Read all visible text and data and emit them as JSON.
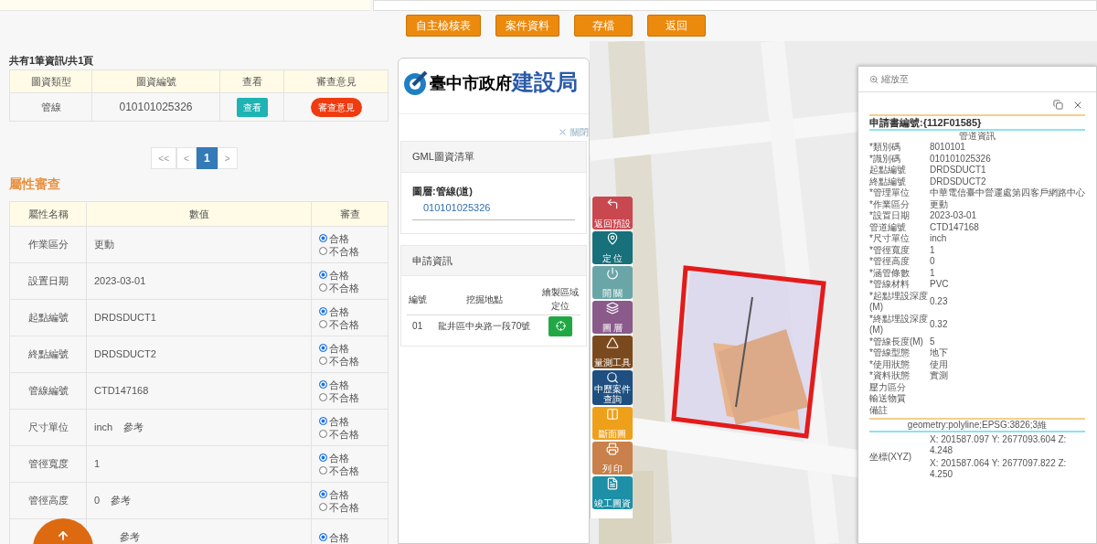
{
  "header_buttons": [
    "自主檢核表",
    "案件資料",
    "存檔",
    "返回"
  ],
  "summary": "共有1筆資訊/共1頁",
  "drawings_table": {
    "columns": [
      "圖資類型",
      "圖資編號",
      "查看",
      "審查意見"
    ],
    "rows": [
      {
        "type": "管線",
        "number": "010101025326",
        "view_button": "查看",
        "review_button": "審查意見"
      }
    ]
  },
  "pagination": [
    {
      "label": "<<",
      "selected": false
    },
    {
      "label": "<",
      "selected": false
    },
    {
      "label": "1",
      "selected": true
    },
    {
      "label": ">",
      "selected": false
    }
  ],
  "section_title": "屬性審查",
  "attributes_table": {
    "columns": [
      "屬性名稱",
      "數值",
      "審查"
    ],
    "rows": [
      {
        "name": "作業區分",
        "value": "更動",
        "options": [
          {
            "label": "合格",
            "selected": true
          },
          {
            "label": "不合格",
            "selected": false
          }
        ]
      },
      {
        "name": "設置日期",
        "value": "2023-03-01",
        "options": [
          {
            "label": "合格",
            "selected": true
          },
          {
            "label": "不合格",
            "selected": false
          }
        ]
      },
      {
        "name": "起點編號",
        "value": "DRDSDUCT1",
        "options": [
          {
            "label": "合格",
            "selected": true
          },
          {
            "label": "不合格",
            "selected": false
          }
        ]
      },
      {
        "name": "終點編號",
        "value": "DRDSDUCT2",
        "options": [
          {
            "label": "合格",
            "selected": true
          },
          {
            "label": "不合格",
            "selected": false
          }
        ]
      },
      {
        "name": "管線編號",
        "value": "CTD147168",
        "options": [
          {
            "label": "合格",
            "selected": true
          },
          {
            "label": "不合格",
            "selected": false
          }
        ]
      },
      {
        "name": "尺寸單位",
        "value": "inch",
        "reference": "參考",
        "options": [
          {
            "label": "合格",
            "selected": true
          },
          {
            "label": "不合格",
            "selected": false
          }
        ]
      },
      {
        "name": "管徑寬度",
        "value": "1",
        "options": [
          {
            "label": "合格",
            "selected": true
          },
          {
            "label": "不合格",
            "selected": false
          }
        ]
      },
      {
        "name": "管徑高度",
        "value": "0",
        "reference": "參考",
        "options": [
          {
            "label": "合格",
            "selected": true
          },
          {
            "label": "不合格",
            "selected": false
          }
        ]
      },
      {
        "reference": "參考",
        "options": [
          {
            "label": "合格",
            "selected": true
          }
        ]
      }
    ]
  },
  "panel": {
    "logo": {
      "city": "臺中市政府",
      "bureau": "建設局"
    },
    "close_link": "關閉",
    "gml": {
      "title": "GML圖資清單",
      "layer": "圖層:管線(道)",
      "item": "010101025326"
    },
    "application": {
      "title": "申請資訊",
      "columns": [
        "編號",
        "挖掘地點",
        "繪製區域定位"
      ],
      "rows": [
        {
          "no": "01",
          "location": "龍井區中央路一段70號"
        }
      ]
    }
  },
  "tools": [
    {
      "kind": "back",
      "label": "返回預設",
      "color": "#c9474f"
    },
    {
      "kind": "locate",
      "label": "定 位",
      "color": "#17707a"
    },
    {
      "kind": "power",
      "label": "開 關",
      "color": "#6aa6a8"
    },
    {
      "kind": "layers",
      "label": "圖 層",
      "color": "#8a5a8a"
    },
    {
      "kind": "measure",
      "label": "量測工具",
      "color": "#7a4a1e"
    },
    {
      "kind": "search",
      "label": "中歷案件查詢",
      "color": "#1e4f80"
    },
    {
      "kind": "split",
      "label": "斷面圖",
      "color": "#eea01a"
    },
    {
      "kind": "print",
      "label": "列 印",
      "color": "#c9804a"
    },
    {
      "kind": "document",
      "label": "竣工圖資",
      "color": "#1d8fa6"
    }
  ],
  "popup": {
    "zoom_label": "縮放至",
    "title": "申請書編號:{112F01585}",
    "section": "管道資訊",
    "fields": [
      {
        "label": "*類別碼",
        "value": "8010101"
      },
      {
        "label": "*識別碼",
        "value": "010101025326"
      },
      {
        "label": "起點編號",
        "value": "DRDSDUCT1"
      },
      {
        "label": "終點編號",
        "value": "DRDSDUCT2"
      },
      {
        "label": "*管理單位",
        "value": "中華電信臺中營運處第四客戶網路中心"
      },
      {
        "label": "*作業區分",
        "value": "更動"
      },
      {
        "label": "*設置日期",
        "value": "2023-03-01"
      },
      {
        "label": "管道編號",
        "value": "CTD147168"
      },
      {
        "label": "*尺寸單位",
        "value": "inch"
      },
      {
        "label": "*管徑寬度",
        "value": "1"
      },
      {
        "label": "*管徑高度",
        "value": "0"
      },
      {
        "label": "*涵管條數",
        "value": "1"
      },
      {
        "label": "*管線材料",
        "value": "PVC"
      },
      {
        "label": "*起點埋設深度(M)",
        "value": "0.23"
      },
      {
        "label": "*終點埋設深度(M)",
        "value": "0.32"
      },
      {
        "label": "*管線長度(M)",
        "value": "5"
      },
      {
        "label": "*管線型態",
        "value": "地下"
      },
      {
        "label": "*使用狀態",
        "value": "使用"
      },
      {
        "label": "*資料狀態",
        "value": "實測"
      },
      {
        "label": "壓力區分"
      },
      {
        "label": "輸送物質"
      },
      {
        "label": "備註"
      }
    ],
    "geometry": "geometry:polyline;EPSG:3826;3維",
    "coordinates": {
      "label": "坐標(XYZ)",
      "values": [
        "X: 201587.097 Y: 2677093.604 Z: 4.248",
        "X: 201587.064 Y: 2677097.822 Z: 4.250"
      ]
    }
  }
}
